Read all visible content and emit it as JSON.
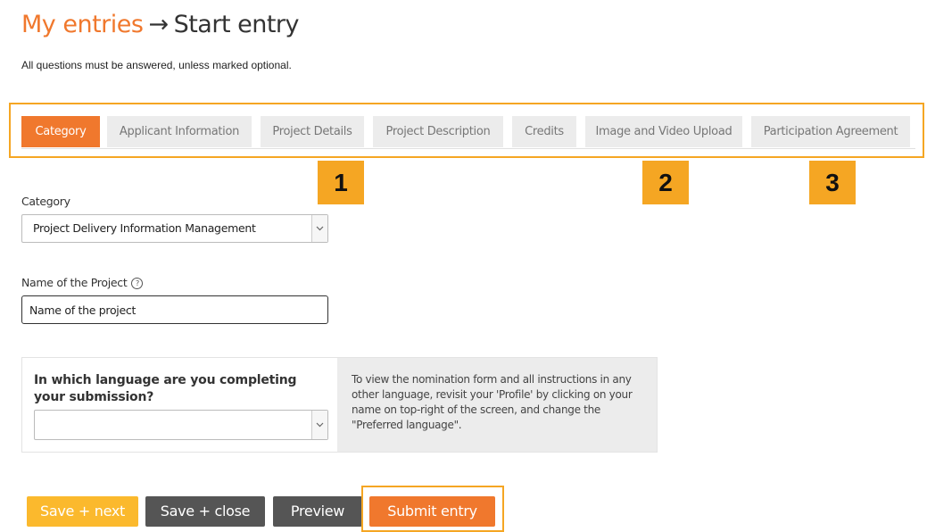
{
  "header": {
    "breadcrumb_parent": "My entries",
    "arrow": "→",
    "current": "Start entry",
    "instructions": "All questions must be answered, unless marked optional."
  },
  "tabs": [
    {
      "label": "Category",
      "active": true
    },
    {
      "label": "Applicant Information",
      "active": false
    },
    {
      "label": "Project Details",
      "active": false
    },
    {
      "label": "Project Description",
      "active": false
    },
    {
      "label": "Credits",
      "active": false
    },
    {
      "label": "Image and Video Upload",
      "active": false
    },
    {
      "label": "Participation Agreement",
      "active": false
    }
  ],
  "badges": [
    "1",
    "2",
    "3"
  ],
  "form": {
    "category_label": "Category",
    "category_value": "Project Delivery Information Management",
    "project_name_label": "Name of the Project",
    "help_icon": "?",
    "project_name_value": "Name of the project",
    "language_question": "In which language are you completing your submission?",
    "language_value": "",
    "language_info": "To view the nomination form and all instructions in any other language, revisit your 'Profile' by clicking on your name on top-right of the screen, and change the \"Preferred language\"."
  },
  "actions": {
    "save_next": "Save + next",
    "save_close": "Save + close",
    "preview": "Preview",
    "submit": "Submit entry"
  },
  "colors": {
    "accent": "#f0782d",
    "highlight": "#f5a623",
    "dark_button": "#555555",
    "save_next": "#fbb92d"
  },
  "icons": {
    "arrow": "arrow-right-icon",
    "help": "help-circle-icon",
    "caret": "chevron-down-icon"
  }
}
